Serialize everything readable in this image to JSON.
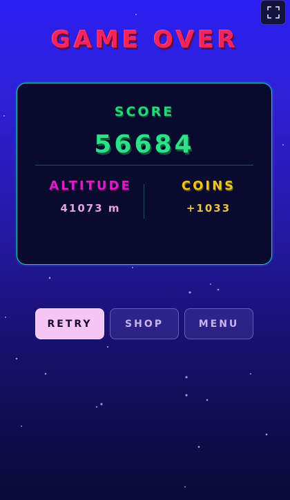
{
  "title": "GAME OVER",
  "score": {
    "label": "SCORE",
    "value": "56684"
  },
  "altitude": {
    "label": "ALTITUDE",
    "value": "41073 m"
  },
  "coins": {
    "label": "COINS",
    "value": "+1033"
  },
  "buttons": {
    "retry": "RETRY",
    "shop": "SHOP",
    "menu": "MENU"
  },
  "colors": {
    "title": "#f0245e",
    "score": "#2ee08a",
    "altitude": "#d51fc8",
    "coins": "#eec61e",
    "panel_border": "#22c5c9"
  },
  "icons": {
    "fullscreen": "fullscreen-icon"
  }
}
